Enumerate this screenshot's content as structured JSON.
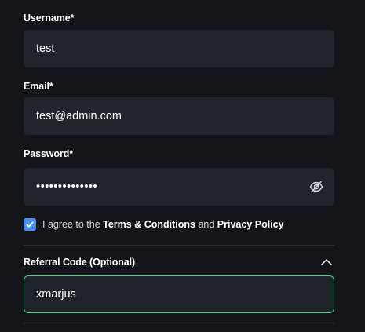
{
  "username": {
    "label": "Username*",
    "value": "test"
  },
  "email": {
    "label": "Email*",
    "value": "test@admin.com"
  },
  "password": {
    "label": "Password*",
    "value": "••••••••••••••",
    "toggle_icon": "eye-slash-icon"
  },
  "agreement": {
    "checked": true,
    "prefix": "I agree to the ",
    "terms": "Terms & Conditions",
    "middle": " and ",
    "privacy": "Privacy Policy"
  },
  "referral": {
    "label": "Referral Code (Optional)",
    "value": "xmarjus",
    "expanded_icon": "chevron-up-icon"
  },
  "colors": {
    "background": "#14151a",
    "field": "#22242b",
    "accent_focus": "#4fd38a",
    "checkbox": "#4a8cf0"
  }
}
